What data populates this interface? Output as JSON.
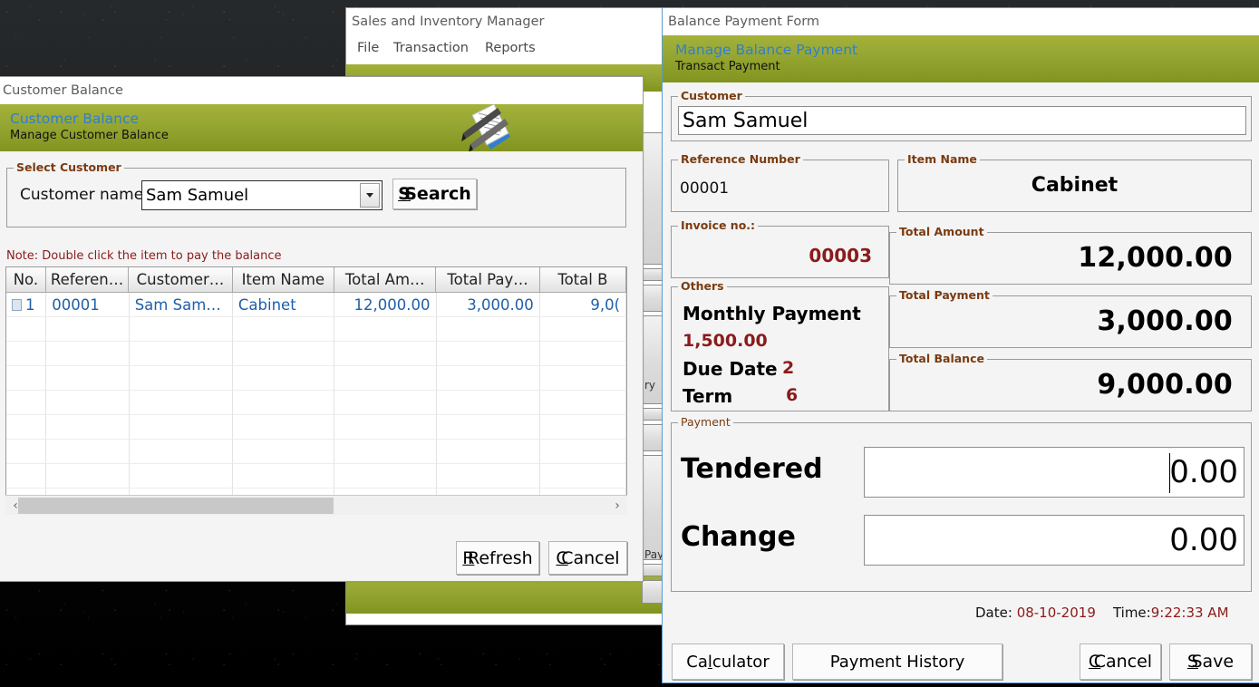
{
  "desktop": {
    "background_color": "#1d1f20"
  },
  "background_app": {
    "title": "Sales and Inventory Manager",
    "menu": [
      "File",
      "Transaction",
      "Reports"
    ],
    "accent_color": "#97a733",
    "partial_labels": [
      "ry",
      "Pay"
    ]
  },
  "customer_balance_window": {
    "title": "Customer Balance",
    "header": {
      "title": "Customer Balance",
      "subtitle": "Manage Customer Balance",
      "icon": "document-pen-icon"
    },
    "select_customer": {
      "legend": "Select Customer",
      "label": "Customer name:",
      "combo_value": "Sam Samuel",
      "search_label": "Search",
      "search_mnemonic": "S"
    },
    "note": "Note: Double click the item to pay the balance",
    "table": {
      "columns": [
        "No.",
        "Referen…",
        "Customer…",
        "Item Name",
        "Total Am…",
        "Total Pay…",
        "Total B"
      ],
      "rows": [
        [
          "1",
          "00001",
          "Sam Sam…",
          "Cabinet",
          "12,000.00",
          "3,000.00",
          "9,0("
        ]
      ],
      "empty_row_count": 8,
      "row_text_color": "#1f5fa9"
    },
    "scrollbar": {
      "left_arrow": "‹",
      "right_arrow": "›"
    },
    "buttons": {
      "refresh": {
        "label": "Refresh",
        "mnemonic": "R"
      },
      "cancel": {
        "label": "Cancel",
        "mnemonic": "C"
      }
    }
  },
  "balance_payment_form": {
    "title": "Balance Payment Form",
    "header": {
      "title": "Manage Balance Payment",
      "subtitle": "Transact Payment"
    },
    "customer": {
      "legend": "Customer",
      "value": "Sam Samuel"
    },
    "reference_number": {
      "legend": "Reference Number",
      "value": "00001"
    },
    "item_name": {
      "legend": "Item Name",
      "value": "Cabinet"
    },
    "invoice_no": {
      "legend": "Invoice no.:",
      "value": "00003"
    },
    "total_amount": {
      "legend": "Total Amount",
      "value": "12,000.00"
    },
    "others": {
      "legend": "Others",
      "monthly_payment_label": "Monthly Payment",
      "monthly_payment_value": "1,500.00",
      "due_date_label": "Due Date",
      "due_date_value": "2",
      "term_label": "Term",
      "term_value": "6"
    },
    "total_payment": {
      "legend": "Total Payment",
      "value": "3,000.00"
    },
    "total_balance": {
      "legend": "Total Balance",
      "value": "9,000.00"
    },
    "payment": {
      "legend": "Payment",
      "tendered_label": "Tendered",
      "tendered_value": "0.00",
      "change_label": "Change",
      "change_value": "0.00"
    },
    "stamp": {
      "date_label": "Date:",
      "date_value": "08-10-2019",
      "time_label": "Time:",
      "time_value": "9:22:33 AM"
    },
    "buttons": {
      "calculator": {
        "label": "Calculator",
        "mnemonic": "l"
      },
      "payment_history": {
        "label": "Payment History"
      },
      "cancel": {
        "label": "Cancel",
        "mnemonic": "C"
      },
      "save": {
        "label": "Save",
        "mnemonic": "S"
      }
    }
  }
}
